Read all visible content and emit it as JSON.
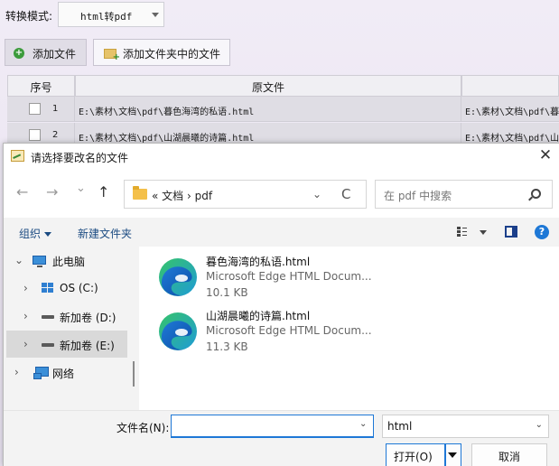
{
  "app": {
    "mode_label": "转换模式:",
    "mode_value": "html转pdf",
    "add_file_button": "添加文件",
    "add_folder_button": "添加文件夹中的文件",
    "grid": {
      "headers": [
        "序号",
        "原文件"
      ],
      "rows": [
        {
          "num": "1",
          "source": "E:\\素材\\文档\\pdf\\暮色海湾的私语.html",
          "target": "E:\\素材\\文档\\pdf\\暮"
        },
        {
          "num": "2",
          "source": "E:\\素材\\文档\\pdf\\山湖晨曦的诗篇.html",
          "target": "E:\\素材\\文档\\pdf\\山"
        }
      ]
    }
  },
  "dialog": {
    "title": "请选择要改名的文件",
    "close_glyph": "✕",
    "nav": {
      "back": "←",
      "forward": "→",
      "recent": "⌄",
      "up": "↑"
    },
    "address": {
      "path": "«  文档  ›  pdf",
      "chevron": "⌄",
      "refresh": "C"
    },
    "search_placeholder": "在 pdf 中搜索",
    "commands": {
      "organize": "组织",
      "new_folder": "新建文件夹",
      "help": "?"
    },
    "tree": [
      {
        "label": "此电脑",
        "chevron": "⌄",
        "icon": "pc-icon"
      },
      {
        "label": "OS (C:)",
        "chevron": "›",
        "icon": "windows-drive-icon"
      },
      {
        "label": "新加卷 (D:)",
        "chevron": "›",
        "icon": "drive-icon"
      },
      {
        "label": "新加卷 (E:)",
        "chevron": "›",
        "icon": "drive-icon",
        "selected": true
      },
      {
        "label": "网络",
        "chevron": "›",
        "icon": "network-icon"
      }
    ],
    "files": [
      {
        "name": "暮色海湾的私语.html",
        "type": "Microsoft Edge HTML Docum...",
        "size": "10.1 KB",
        "icon": "edge-icon"
      },
      {
        "name": "山湖晨曦的诗篇.html",
        "type": "Microsoft Edge HTML Docum...",
        "size": "11.3 KB",
        "icon": "edge-icon"
      }
    ],
    "filename_label": "文件名(N):",
    "filename_value": "",
    "filetype_value": "html",
    "open_button": "打开(O)",
    "cancel_button": "取消",
    "colors": {
      "accent": "#1e78d6",
      "edge_blue": "#1e78d6",
      "edge_green": "#3cc36a"
    }
  }
}
